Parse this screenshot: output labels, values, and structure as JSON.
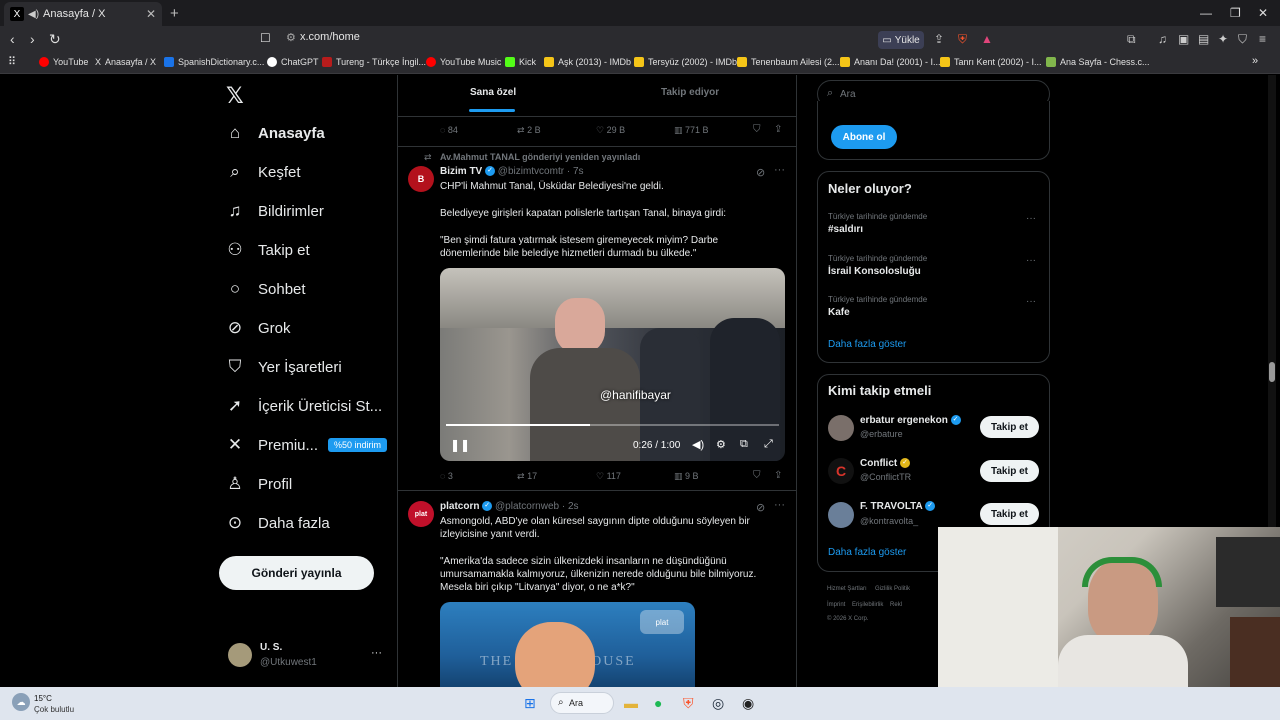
{
  "browser": {
    "tab_title": "Anasayfa / X",
    "url": "x.com/home",
    "upload_label": "Yükle",
    "bookmarks": [
      {
        "label": "YouTube",
        "color": "#ff0000"
      },
      {
        "label": "Anasayfa / X",
        "color": "#000000"
      },
      {
        "label": "SpanishDictionary.c...",
        "color": "#1a73e8"
      },
      {
        "label": "ChatGPT",
        "color": "#ffffff"
      },
      {
        "label": "Tureng - Türkçe İngil...",
        "color": "#b71c1c"
      },
      {
        "label": "YouTube Music",
        "color": "#ff0000"
      },
      {
        "label": "Kick",
        "color": "#53fc18"
      },
      {
        "label": "Aşk (2013) - IMDb",
        "color": "#f5c518"
      },
      {
        "label": "Tersyüz (2002) - IMDb",
        "color": "#f5c518"
      },
      {
        "label": "Tenenbaum Ailesi (2...",
        "color": "#f5c518"
      },
      {
        "label": "Ananı Da! (2001) - I...",
        "color": "#f5c518"
      },
      {
        "label": "Tanrı Kent (2002) - I...",
        "color": "#f5c518"
      },
      {
        "label": "Ana Sayfa - Chess.c...",
        "color": "#81b64c"
      }
    ]
  },
  "sidebar": {
    "items": [
      {
        "label": "Anasayfa",
        "icon": "home-icon"
      },
      {
        "label": "Keşfet",
        "icon": "search-icon"
      },
      {
        "label": "Bildirimler",
        "icon": "bell-icon"
      },
      {
        "label": "Takip et",
        "icon": "add-user-icon"
      },
      {
        "label": "Sohbet",
        "icon": "chat-icon"
      },
      {
        "label": "Grok",
        "icon": "grok-icon"
      },
      {
        "label": "Yer İşaretleri",
        "icon": "bookmark-icon"
      },
      {
        "label": "İçerik Üreticisi St...",
        "icon": "rocket-icon"
      },
      {
        "label": "Premiu...",
        "icon": "x-icon",
        "badge": "%50 indirim"
      },
      {
        "label": "Profil",
        "icon": "profile-icon"
      },
      {
        "label": "Daha fazla",
        "icon": "more-icon"
      }
    ],
    "post_button": "Gönderi yayınla",
    "account": {
      "name": "U. S.",
      "handle": "@Utkuwest1"
    }
  },
  "feed": {
    "tabs": [
      "Sana özel",
      "Takip ediyor"
    ],
    "top_actions": {
      "replies": "84",
      "reposts": "2 B",
      "likes": "29 B",
      "views": "771 B"
    },
    "tweet1": {
      "repost_note": "Av.Mahmut TANAL gönderiyi yeniden yayınladı",
      "author": "Bizim TV",
      "handle": "@bizimtvcomtr",
      "time": "· 7s",
      "line1": "CHP'li Mahmut Tanal, Üsküdar Belediyesi'ne geldi.",
      "line2": "Belediyeye girişleri kapatan polislerle tartışan Tanal, binaya girdi:",
      "line3": "\"Ben şimdi fatura yatırmak istesem giremeyecek miyim? Darbe",
      "line4": "dönemlerinde bile belediye hizmetleri durmadı bu ülkede.\"",
      "video_watermark": "@hanifibayar",
      "video_time": "0:26 / 1:00",
      "actions": {
        "replies": "3",
        "reposts": "17",
        "likes": "117",
        "views": "9 B"
      }
    },
    "tweet2": {
      "author": "platcorn",
      "handle": "@platcornweb",
      "time": "· 2s",
      "line1": "Asmongold, ABD'ye olan küresel saygının dipte olduğunu söyleyen bir",
      "line2": "izleyicisine yanıt verdi.",
      "line3": "\"Amerika'da sadece sizin ülkenizdeki insanların ne düşündüğünü",
      "line4": "umursamamakla kalmıyoruz, ülkenizin nerede olduğunu bile bilmiyoruz.",
      "line5": "Mesela biri çıkıp \"Litvanya\" diyor, o ne a*k?\"",
      "image_text": "THE WHITE HOUSE"
    }
  },
  "right": {
    "search_placeholder": "Ara",
    "subscribe_button": "Abone ol",
    "trends_title": "Neler oluyor?",
    "trends": [
      {
        "context": "Türkiye tarihinde gündemde",
        "name": "#saldırı"
      },
      {
        "context": "Türkiye tarihinde gündemde",
        "name": "İsrail Konsolosluğu"
      },
      {
        "context": "Türkiye tarihinde gündemde",
        "name": "Kafe"
      }
    ],
    "show_more": "Daha fazla göster",
    "follow_title": "Kimi takip etmeli",
    "follow": [
      {
        "name": "erbatur ergenekon",
        "handle": "@erbature"
      },
      {
        "name": "Conflict",
        "handle": "@ConflictTR"
      },
      {
        "name": "F. TRAVOLTA",
        "handle": "@kontravolta_"
      }
    ],
    "follow_button": "Takip et",
    "footer1": "Hizmet Şartları",
    "footer2": "Gizlilik Politik",
    "footer3": "İmprint",
    "footer4": "Erişilebilirlik",
    "footer5": "Rekl",
    "footer6": "© 2026 X Corp."
  },
  "taskbar": {
    "temp": "15°C",
    "weather": "Çok bulutlu",
    "search": "Ara"
  }
}
